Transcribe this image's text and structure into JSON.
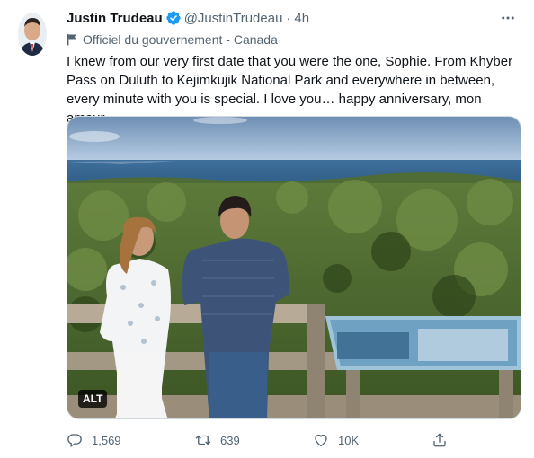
{
  "tweet": {
    "author_name": "Justin Trudeau",
    "handle": "@JustinTrudeau",
    "separator": "·",
    "time": "4h",
    "more_icon": "more-horizontal-icon",
    "verified_icon": "verified-badge-icon",
    "label_icon": "government-flag-icon",
    "label": "Officiel du gouvernement - Canada",
    "text": "I knew from our very first date that you were the one, Sophie. From Khyber Pass on Duluth to Kejimkujik National Park and everywhere in between, every minute with you is special. I love you… happy anniversary, mon amour.",
    "media": {
      "alt_badge": "ALT"
    },
    "actions": {
      "reply_count": "1,569",
      "retweet_count": "639",
      "like_count": "10K"
    }
  },
  "colors": {
    "verified": "#1d9bf0",
    "muted": "#536471",
    "text": "#0f1419"
  }
}
